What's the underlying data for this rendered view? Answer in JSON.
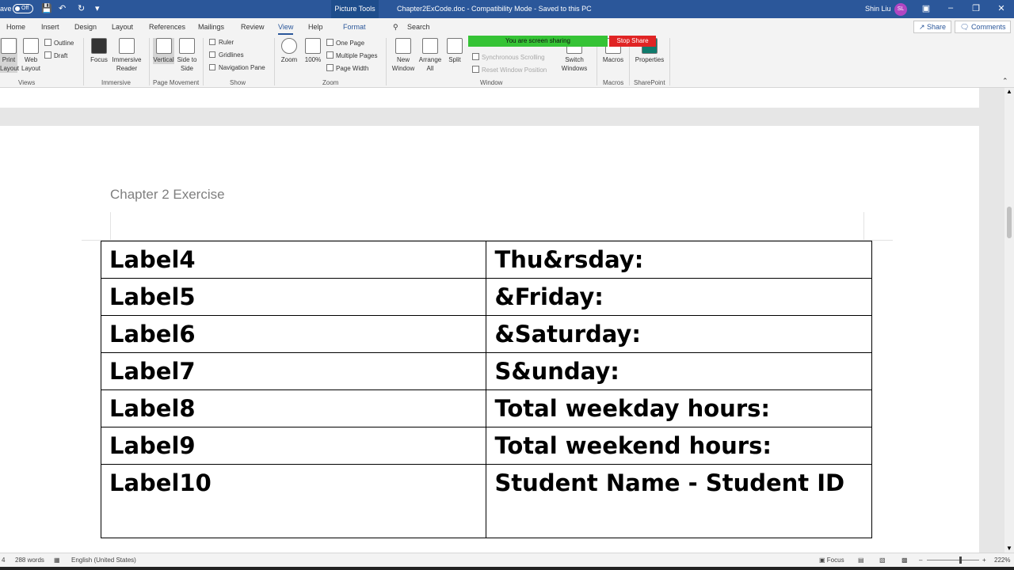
{
  "titlebar": {
    "autosave_label": "ave",
    "autosave_state": "Off",
    "picture_tools": "Picture Tools",
    "title": "Chapter2ExCode.doc  -  Compatibility Mode  -  Saved to this PC",
    "user_name": "Shin Liu",
    "user_initials": "SL"
  },
  "tabs": [
    "Home",
    "Insert",
    "Design",
    "Layout",
    "References",
    "Mailings",
    "Review",
    "View",
    "Help",
    "Format"
  ],
  "search_label": "Search",
  "share_label": "Share",
  "comments_label": "Comments",
  "ribbon": {
    "views": {
      "print_layout": "Print Layout",
      "web_layout": "Web Layout",
      "outline": "Outline",
      "draft": "Draft",
      "group": "Views"
    },
    "immersive": {
      "focus": "Focus",
      "reader": "Immersive Reader",
      "group": "Immersive"
    },
    "page_movement": {
      "vertical": "Vertical",
      "side": "Side to Side",
      "group": "Page Movement"
    },
    "show": {
      "ruler": "Ruler",
      "gridlines": "Gridlines",
      "nav_pane": "Navigation Pane",
      "group": "Show"
    },
    "zoom": {
      "zoom": "Zoom",
      "hundred": "100%",
      "one_page": "One Page",
      "multiple": "Multiple Pages",
      "page_width": "Page Width",
      "group": "Zoom"
    },
    "window": {
      "new_window": "New Window",
      "arrange_all": "Arrange All",
      "split": "Split",
      "sync_scroll": "Synchronous Scrolling",
      "reset_pos": "Reset Window Position",
      "switch": "Switch Windows",
      "group": "Window"
    },
    "macros": {
      "macros": "Macros",
      "group": "Macros"
    },
    "sharepoint": {
      "properties": "Properties",
      "group": "SharePoint"
    },
    "screen_sharing": "You are screen sharing",
    "stop_share": "Stop Share"
  },
  "document": {
    "heading": "Chapter 2 Exercise",
    "rows": [
      [
        "Label4",
        "Thu&rsday:"
      ],
      [
        "Label5",
        "&Friday:"
      ],
      [
        "Label6",
        "&Saturday:"
      ],
      [
        "Label7",
        "S&unday:"
      ],
      [
        "Label8",
        "Total weekday hours:"
      ],
      [
        "Label9",
        "Total weekend hours:"
      ],
      [
        "Label10",
        "Student Name - Student ID"
      ]
    ]
  },
  "statusbar": {
    "page": "4",
    "words": "288 words",
    "language": "English (United States)",
    "focus": "Focus",
    "zoom": "222%"
  }
}
